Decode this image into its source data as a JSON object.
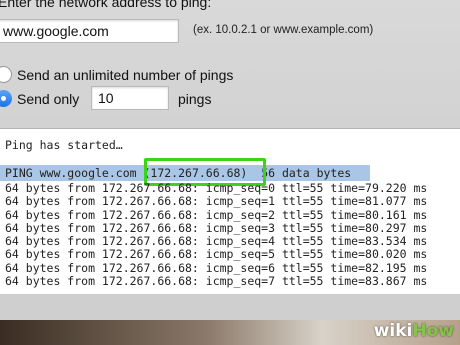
{
  "form": {
    "prompt": "Enter the network address to ping:",
    "address_value": "www.google.com",
    "address_example": "(ex. 10.0.2.1 or www.example.com)",
    "option_unlimited": "Send an unlimited number of pings",
    "option_send_only": "Send only",
    "count_value": "10",
    "pings_label": "pings",
    "selected_option": "send_only"
  },
  "output": {
    "started": "Ping has started…",
    "header_prefix": "PING www.google.com ",
    "header_ip": "(172.267.66.68)",
    "header_suffix": "  56 data bytes",
    "rows": [
      "64 bytes from 172.267.66.68: icmp_seq=0 ttl=55 time=79.220 ms",
      "64 bytes from 172.267.66.68: icmp_seq=1 ttl=55 time=81.077 ms",
      "64 bytes from 172.267.66.68: icmp_seq=2 ttl=55 time=80.161 ms",
      "64 bytes from 172.267.66.68: icmp_seq=3 ttl=55 time=80.297 ms",
      "64 bytes from 172.267.66.68: icmp_seq=4 ttl=55 time=83.534 ms",
      "64 bytes from 172.267.66.68: icmp_seq=5 ttl=55 time=80.020 ms",
      "64 bytes from 172.267.66.68: icmp_seq=6 ttl=55 time=82.195 ms",
      "64 bytes from 172.267.66.68: icmp_seq=7 ttl=55 time=83.867 ms"
    ],
    "highlight_color": "#3bd41b"
  },
  "watermark": {
    "wiki": "wiki",
    "how": "How"
  }
}
